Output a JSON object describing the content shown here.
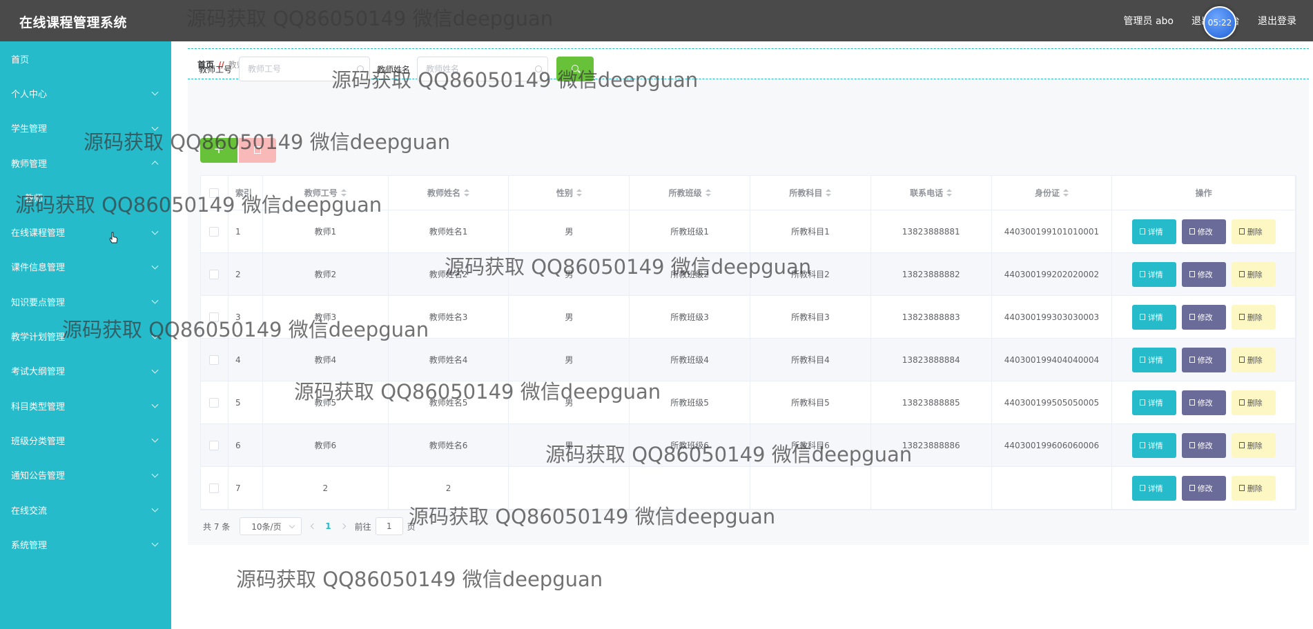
{
  "header": {
    "app_title": "在线课程管理系统",
    "user_label": "管理员 abo",
    "exit_front_label": "退出到前台",
    "logout_label": "退出登录",
    "clock": "05:22"
  },
  "sidebar": {
    "items": [
      {
        "label": "首页",
        "has_children": false
      },
      {
        "label": "个人中心",
        "has_children": true
      },
      {
        "label": "学生管理",
        "has_children": true
      },
      {
        "label": "教师管理",
        "has_children": true,
        "expanded": true
      },
      {
        "label": "教师",
        "has_children": false,
        "sub": true
      },
      {
        "label": "在线课程管理",
        "has_children": true
      },
      {
        "label": "课件信息管理",
        "has_children": true
      },
      {
        "label": "知识要点管理",
        "has_children": true
      },
      {
        "label": "教学计划管理",
        "has_children": true
      },
      {
        "label": "考试大纲管理",
        "has_children": true
      },
      {
        "label": "科目类型管理",
        "has_children": true
      },
      {
        "label": "班级分类管理",
        "has_children": true
      },
      {
        "label": "通知公告管理",
        "has_children": true
      },
      {
        "label": "在线交流",
        "has_children": true
      },
      {
        "label": "系统管理",
        "has_children": true
      }
    ]
  },
  "breadcrumb": {
    "home": "首页",
    "separator": "//",
    "current": "教师"
  },
  "search": {
    "teacher_no_label": "教师工号",
    "teacher_no_placeholder": "教师工号",
    "teacher_name_label": "教师姓名",
    "teacher_name_placeholder": "教师姓名",
    "add_label": "+"
  },
  "table": {
    "columns": [
      "索引",
      "教师工号",
      "教师姓名",
      "性别",
      "所教班级",
      "所教科目",
      "联系电话",
      "身份证",
      "操作"
    ],
    "rows": [
      {
        "index": "1",
        "no": "教师1",
        "name": "教师姓名1",
        "gender": "男",
        "class": "所教班级1",
        "subject": "所教科目1",
        "phone": "13823888881",
        "id_card": "440300199101010001"
      },
      {
        "index": "2",
        "no": "教师2",
        "name": "教师姓名2",
        "gender": "男",
        "class": "所教班级2",
        "subject": "所教科目2",
        "phone": "13823888882",
        "id_card": "440300199202020002"
      },
      {
        "index": "3",
        "no": "教师3",
        "name": "教师姓名3",
        "gender": "男",
        "class": "所教班级3",
        "subject": "所教科目3",
        "phone": "13823888883",
        "id_card": "440300199303030003"
      },
      {
        "index": "4",
        "no": "教师4",
        "name": "教师姓名4",
        "gender": "男",
        "class": "所教班级4",
        "subject": "所教科目4",
        "phone": "13823888884",
        "id_card": "440300199404040004"
      },
      {
        "index": "5",
        "no": "教师5",
        "name": "教师姓名5",
        "gender": "男",
        "class": "所教班级5",
        "subject": "所教科目5",
        "phone": "13823888885",
        "id_card": "440300199505050005"
      },
      {
        "index": "6",
        "no": "教师6",
        "name": "教师姓名6",
        "gender": "男",
        "class": "所教班级6",
        "subject": "所教科目6",
        "phone": "13823888886",
        "id_card": "440300199606060006"
      },
      {
        "index": "7",
        "no": "2",
        "name": "2",
        "gender": "",
        "class": "",
        "subject": "",
        "phone": "",
        "id_card": ""
      }
    ],
    "actions": {
      "detail": "详情",
      "edit": "修改",
      "delete": "删除"
    }
  },
  "pagination": {
    "total": "共 7 条",
    "page_size": "10条/页",
    "current_page": "1",
    "goto_prefix": "前往",
    "goto_value": "1",
    "goto_suffix": "页"
  },
  "watermark": {
    "text": "源码获取 QQ86050149 微信deepguan"
  },
  "colors": {
    "sidebar": "#25bbcb",
    "topbar": "#4a4a4a",
    "success": "#67c23a",
    "edit": "#6b6b9a",
    "delete": "#fdf7c3"
  }
}
